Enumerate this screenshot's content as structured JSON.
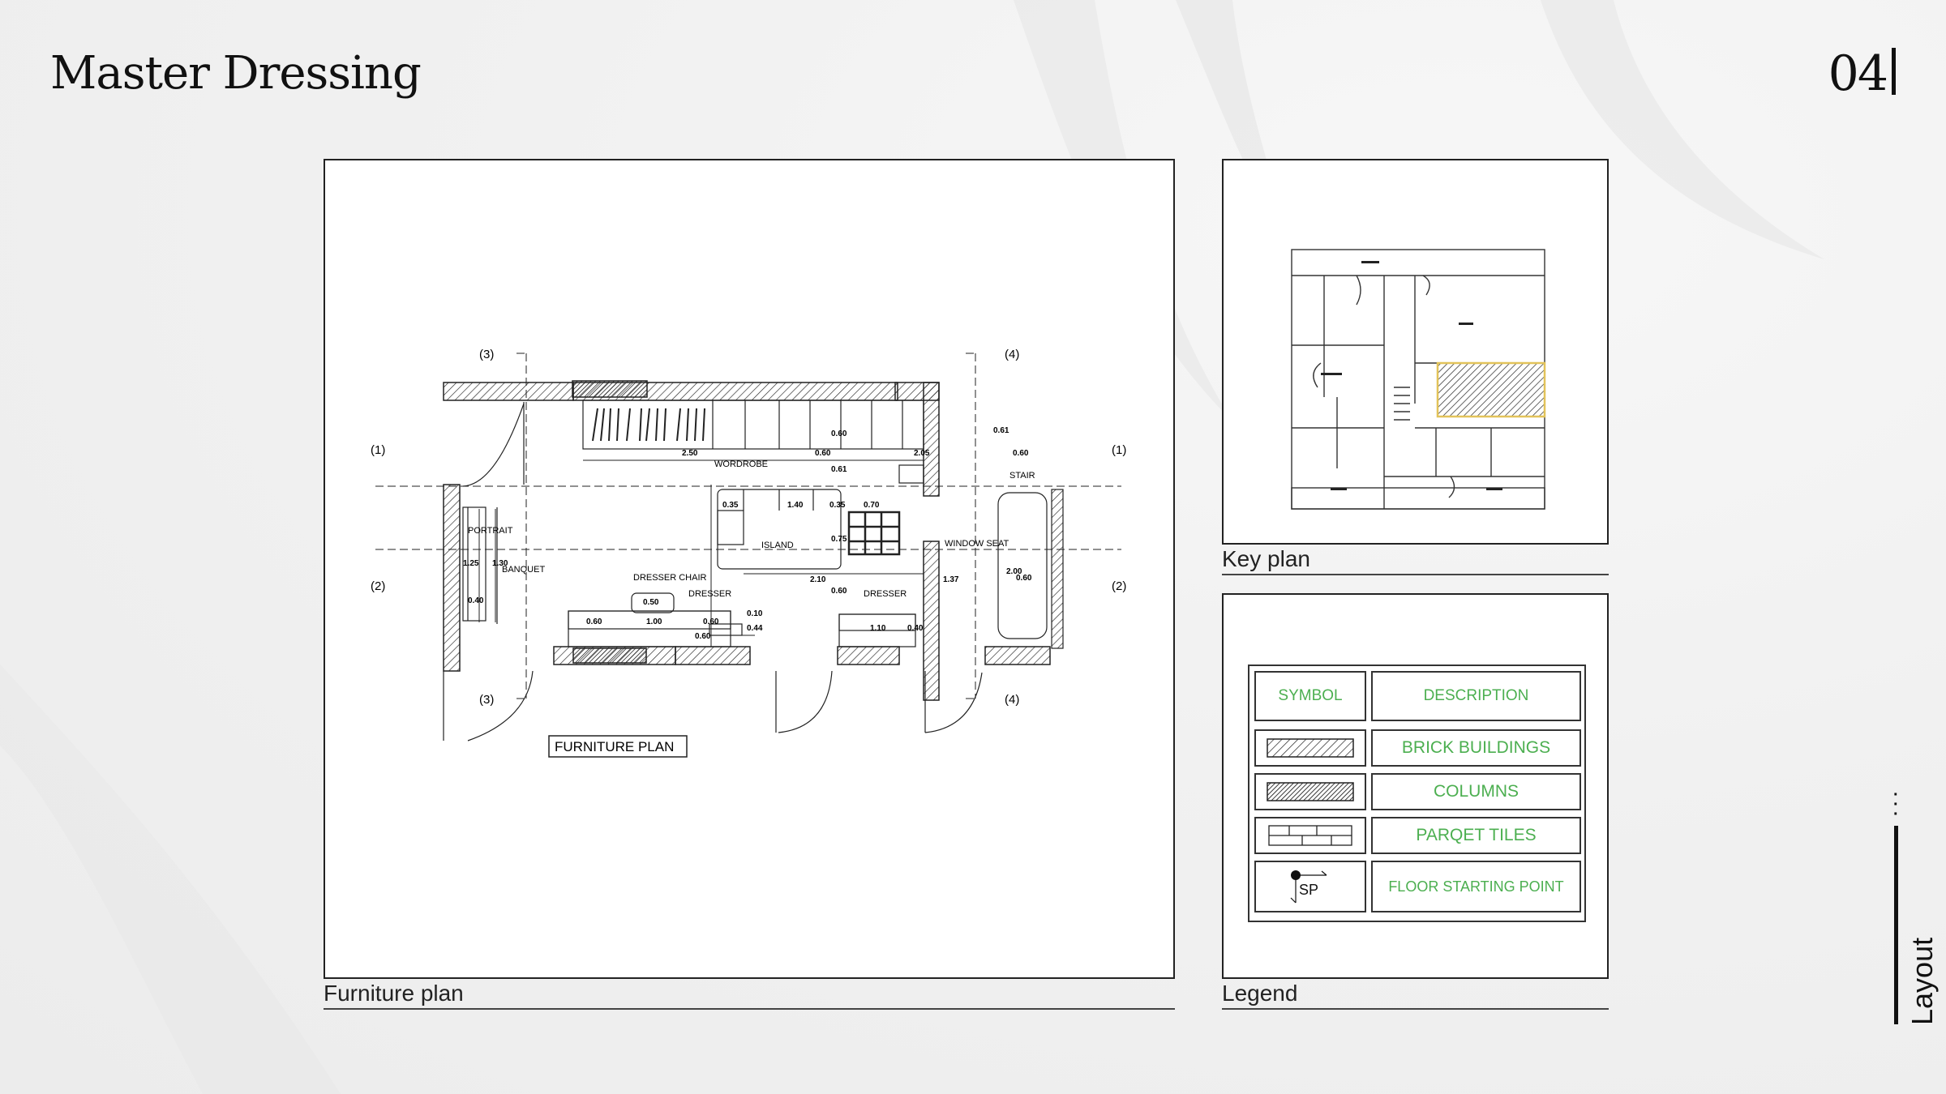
{
  "page": {
    "title": "Master Dressing",
    "number": "04",
    "side_label": "Layout"
  },
  "panels": {
    "furniture": {
      "caption": "Furniture plan",
      "plan_title": "FURNITURE PLAN",
      "labels": {
        "wordrobe": "WORDROBE",
        "stair": "STAIR",
        "island": "ISLAND",
        "window_seat": "WINDOW SEAT",
        "portrait": "PORTRAIT",
        "banquet": "BANQUET",
        "dresser_chair": "DRESSER CHAIR",
        "dresser_1": "DRESSER",
        "dresser_2": "DRESSER"
      },
      "section_marks": {
        "s1": "(1)",
        "s2": "(2)",
        "s3": "(3)",
        "s4": "(4)"
      },
      "dimensions": {
        "d_250": "2.50",
        "d_060a": "0.60",
        "d_205": "2.05",
        "d_060b": "0.60",
        "d_061a": "0.61",
        "d_061b": "0.61",
        "d_060c": "0.60",
        "d_035a": "0.35",
        "d_140": "1.40",
        "d_035b": "0.35",
        "d_070": "0.70",
        "d_075": "0.75",
        "d_210": "2.10",
        "d_137": "1.37",
        "d_060d": "0.60",
        "d_200": "2.00",
        "d_060e": "0.60",
        "d_125": "1.25",
        "d_130": "1.30",
        "d_040a": "0.40",
        "d_050": "0.50",
        "d_060f": "0.60",
        "d_100": "1.00",
        "d_060g": "0.60",
        "d_010": "0.10",
        "d_044": "0.44",
        "d_110": "1.10",
        "d_040b": "0.40",
        "d_060h": "0.60"
      }
    },
    "keyplan": {
      "caption": "Key plan"
    },
    "legend": {
      "caption": "Legend",
      "header_symbol": "SYMBOL",
      "header_description": "DESCRIPTION",
      "rows": [
        {
          "symbol": "hatch-brick",
          "description": "BRICK BUILDINGS"
        },
        {
          "symbol": "hatch-column",
          "description": "COLUMNS"
        },
        {
          "symbol": "parquet-tiles",
          "description": "PARQET TILES"
        },
        {
          "symbol": "floor-start-marker",
          "marker_text": "SP",
          "description": "FLOOR STARTING POINT"
        }
      ]
    }
  },
  "colors": {
    "legend_text": "#4caf50",
    "highlight": "#e2c35a",
    "ink": "#111111"
  }
}
